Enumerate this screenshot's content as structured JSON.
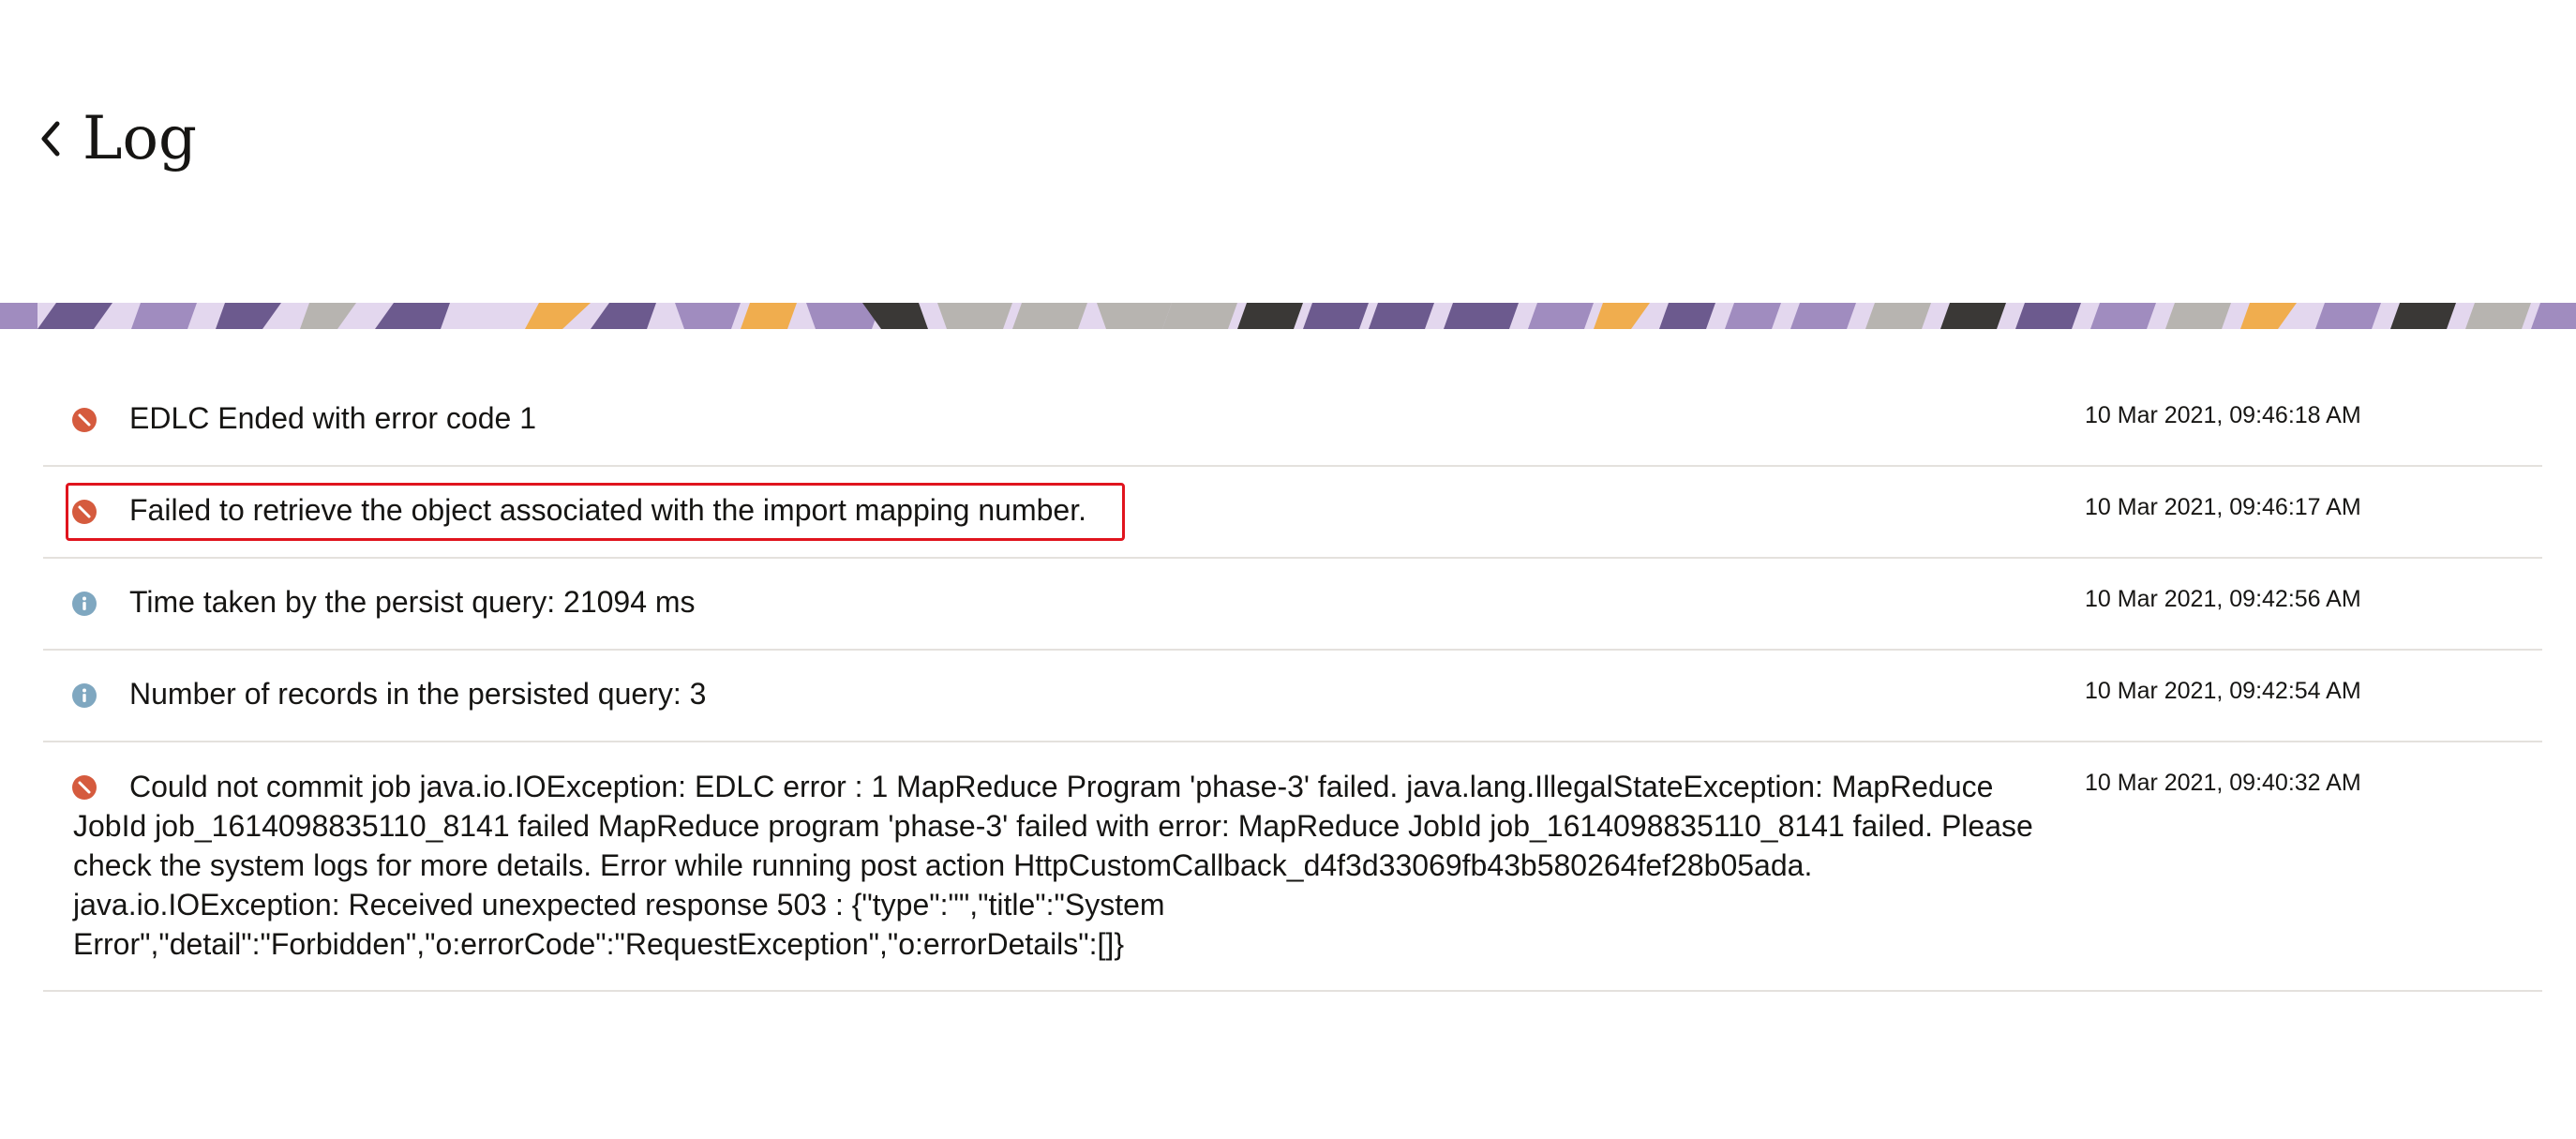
{
  "header": {
    "title": "Log",
    "back_icon": "chevron-left-icon"
  },
  "banner": {
    "colors": [
      "#6c5a8e",
      "#a08cbf",
      "#e3d7ee",
      "#f0ad4e",
      "#3a3836",
      "#b7b4b0"
    ]
  },
  "colors": {
    "error": "#d55b3e",
    "info": "#7fa7c0",
    "highlight": "#e0141e"
  },
  "logs": [
    {
      "status": "error",
      "icon": "error-icon",
      "message": "EDLC Ended with error code 1",
      "timestamp": "10 Mar 2021, 09:46:18 AM"
    },
    {
      "status": "error",
      "icon": "error-icon",
      "message": "Failed to retrieve the object associated with the import mapping number.",
      "timestamp": "10 Mar 2021, 09:46:17 AM",
      "highlighted": true
    },
    {
      "status": "info",
      "icon": "info-icon",
      "message": "Time taken by the persist query: 21094 ms",
      "timestamp": "10 Mar 2021, 09:42:56 AM"
    },
    {
      "status": "info",
      "icon": "info-icon",
      "message": "Number of records in the persisted query: 3",
      "timestamp": "10 Mar 2021, 09:42:54 AM"
    },
    {
      "status": "error",
      "icon": "error-icon",
      "message": "Could not commit job java.io.IOException: EDLC error : 1 MapReduce Program 'phase-3' failed. java.lang.IllegalStateException: MapReduce JobId job_1614098835110_8141 failed MapReduce program 'phase-3' failed with error: MapReduce JobId job_1614098835110_8141 failed. Please check the system logs for more details. Error while running post action HttpCustomCallback_d4f3d33069fb43b580264fef28b05ada. java.io.IOException: Received unexpected response 503 : {\"type\":\"\",\"title\":\"System Error\",\"detail\":\"Forbidden\",\"o:errorCode\":\"RequestException\",\"o:errorDetails\":[]}",
      "timestamp": "10 Mar 2021, 09:40:32 AM"
    }
  ]
}
